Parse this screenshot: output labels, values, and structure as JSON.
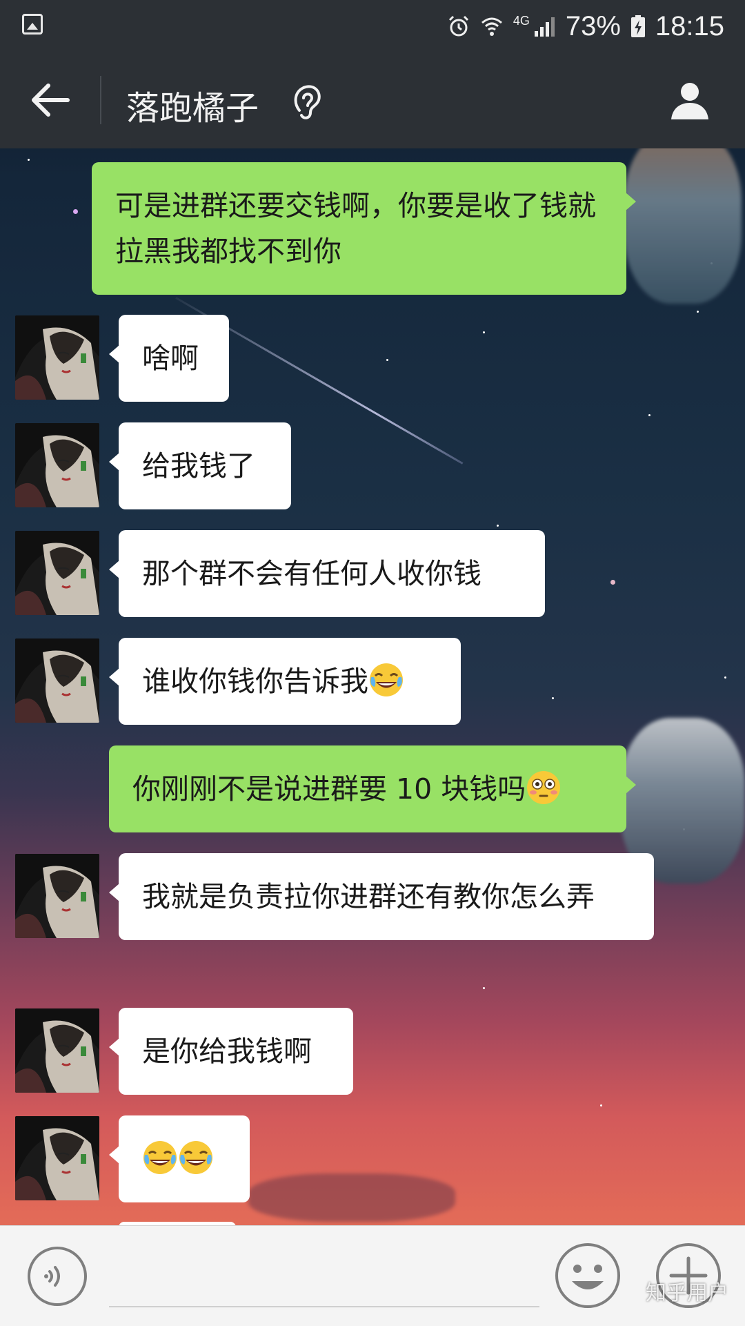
{
  "status_bar": {
    "battery": "73%",
    "time": "18:15",
    "network": "4G"
  },
  "header": {
    "title": "落跑橘子"
  },
  "messages": [
    {
      "side": "out",
      "text": "可是进群还要交钱啊，你要是收了钱就拉黑我都找不到你"
    },
    {
      "side": "in",
      "text": "啥啊"
    },
    {
      "side": "in",
      "text": "给我钱了"
    },
    {
      "side": "in",
      "text": "那个群不会有任何人收你钱"
    },
    {
      "side": "in",
      "text": "谁收你钱你告诉我",
      "emoji": "joy"
    },
    {
      "side": "out",
      "text": "你刚刚不是说进群要 10 块钱吗",
      "emoji": "flushed"
    },
    {
      "side": "in",
      "text": "我就是负责拉你进群还有教你怎么弄"
    },
    {
      "side": "in",
      "text": "是你给我钱啊"
    },
    {
      "side": "in",
      "text": "",
      "emoji": "joy-joy"
    }
  ],
  "input_bar": {
    "text_value": ""
  },
  "watermark": "知乎用户",
  "colors": {
    "outgoing_bubble": "#98e165",
    "incoming_bubble": "#ffffff",
    "topbar": "#2c3035"
  }
}
